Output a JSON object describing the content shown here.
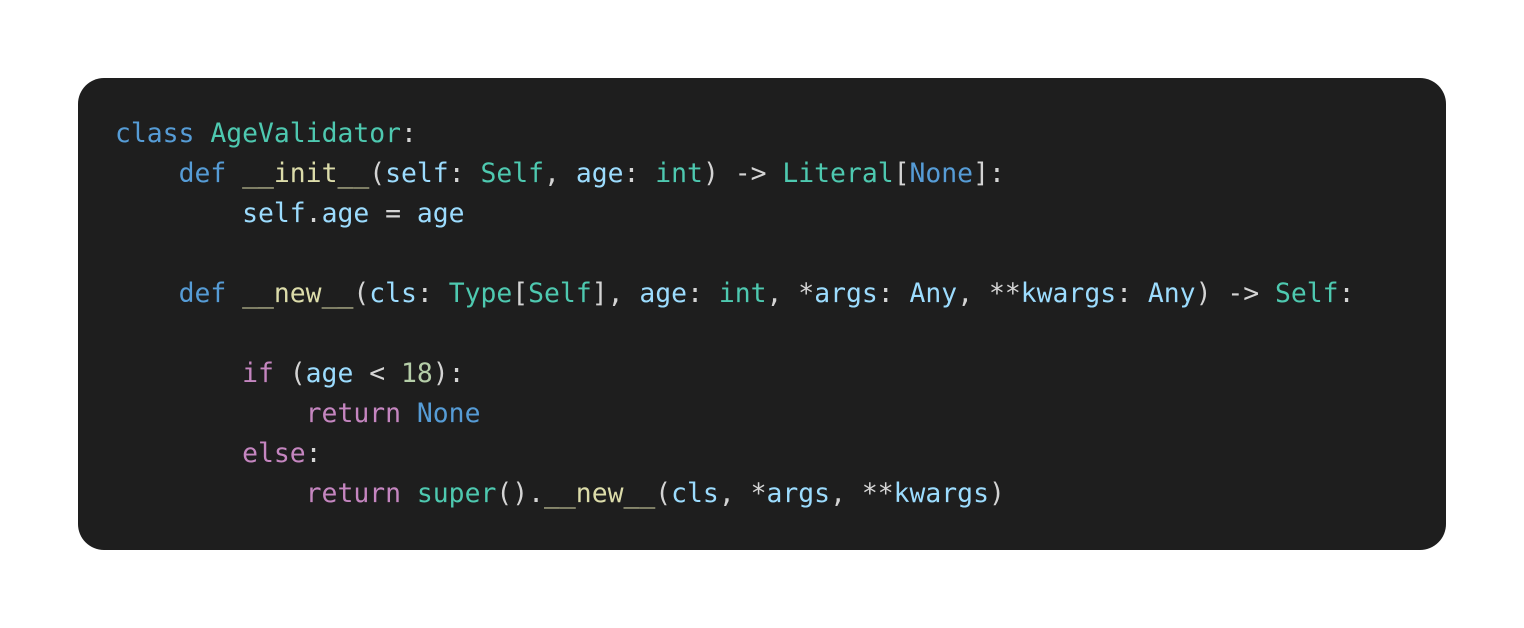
{
  "colors": {
    "background": "#ffffff",
    "card": "#1e1e1e",
    "keyword": "#569cd6",
    "control": "#c586c0",
    "class_type": "#4ec9b0",
    "function": "#dcdcaa",
    "variable": "#9cdcfe",
    "number": "#b5cea8",
    "punctuation": "#d4d4d4"
  },
  "code": {
    "language": "python",
    "lines": [
      [
        {
          "text": "class",
          "kind": "keyword"
        },
        {
          "text": " ",
          "kind": "punctuation"
        },
        {
          "text": "AgeValidator",
          "kind": "class_type"
        },
        {
          "text": ":",
          "kind": "punctuation"
        }
      ],
      [
        {
          "text": "    ",
          "kind": "punctuation"
        },
        {
          "text": "def",
          "kind": "keyword"
        },
        {
          "text": " ",
          "kind": "punctuation"
        },
        {
          "text": "__init__",
          "kind": "function"
        },
        {
          "text": "(",
          "kind": "punctuation"
        },
        {
          "text": "self",
          "kind": "variable"
        },
        {
          "text": ": ",
          "kind": "punctuation"
        },
        {
          "text": "Self",
          "kind": "class_type"
        },
        {
          "text": ", ",
          "kind": "punctuation"
        },
        {
          "text": "age",
          "kind": "variable"
        },
        {
          "text": ": ",
          "kind": "punctuation"
        },
        {
          "text": "int",
          "kind": "class_type"
        },
        {
          "text": ") -> ",
          "kind": "punctuation"
        },
        {
          "text": "Literal",
          "kind": "class_type"
        },
        {
          "text": "[",
          "kind": "punctuation"
        },
        {
          "text": "None",
          "kind": "keyword"
        },
        {
          "text": "]:",
          "kind": "punctuation"
        }
      ],
      [
        {
          "text": "        ",
          "kind": "punctuation"
        },
        {
          "text": "self",
          "kind": "variable"
        },
        {
          "text": ".",
          "kind": "punctuation"
        },
        {
          "text": "age",
          "kind": "variable"
        },
        {
          "text": " = ",
          "kind": "punctuation"
        },
        {
          "text": "age",
          "kind": "variable"
        }
      ],
      [],
      [
        {
          "text": "    ",
          "kind": "punctuation"
        },
        {
          "text": "def",
          "kind": "keyword"
        },
        {
          "text": " ",
          "kind": "punctuation"
        },
        {
          "text": "__new__",
          "kind": "function"
        },
        {
          "text": "(",
          "kind": "punctuation"
        },
        {
          "text": "cls",
          "kind": "variable"
        },
        {
          "text": ": ",
          "kind": "punctuation"
        },
        {
          "text": "Type",
          "kind": "class_type"
        },
        {
          "text": "[",
          "kind": "punctuation"
        },
        {
          "text": "Self",
          "kind": "class_type"
        },
        {
          "text": "], ",
          "kind": "punctuation"
        },
        {
          "text": "age",
          "kind": "variable"
        },
        {
          "text": ": ",
          "kind": "punctuation"
        },
        {
          "text": "int",
          "kind": "class_type"
        },
        {
          "text": ", *",
          "kind": "punctuation"
        },
        {
          "text": "args",
          "kind": "variable"
        },
        {
          "text": ": ",
          "kind": "punctuation"
        },
        {
          "text": "Any",
          "kind": "variable"
        },
        {
          "text": ", **",
          "kind": "punctuation"
        },
        {
          "text": "kwargs",
          "kind": "variable"
        },
        {
          "text": ": ",
          "kind": "punctuation"
        },
        {
          "text": "Any",
          "kind": "variable"
        },
        {
          "text": ") -> ",
          "kind": "punctuation"
        },
        {
          "text": "Self",
          "kind": "class_type"
        },
        {
          "text": ":",
          "kind": "punctuation"
        }
      ],
      [],
      [
        {
          "text": "        ",
          "kind": "punctuation"
        },
        {
          "text": "if",
          "kind": "control"
        },
        {
          "text": " (",
          "kind": "punctuation"
        },
        {
          "text": "age",
          "kind": "variable"
        },
        {
          "text": " < ",
          "kind": "punctuation"
        },
        {
          "text": "18",
          "kind": "number"
        },
        {
          "text": "):",
          "kind": "punctuation"
        }
      ],
      [
        {
          "text": "            ",
          "kind": "punctuation"
        },
        {
          "text": "return",
          "kind": "control"
        },
        {
          "text": " ",
          "kind": "punctuation"
        },
        {
          "text": "None",
          "kind": "keyword"
        }
      ],
      [
        {
          "text": "        ",
          "kind": "punctuation"
        },
        {
          "text": "else",
          "kind": "control"
        },
        {
          "text": ":",
          "kind": "punctuation"
        }
      ],
      [
        {
          "text": "            ",
          "kind": "punctuation"
        },
        {
          "text": "return",
          "kind": "control"
        },
        {
          "text": " ",
          "kind": "punctuation"
        },
        {
          "text": "super",
          "kind": "class_type"
        },
        {
          "text": "().",
          "kind": "punctuation"
        },
        {
          "text": "__new__",
          "kind": "function"
        },
        {
          "text": "(",
          "kind": "punctuation"
        },
        {
          "text": "cls",
          "kind": "variable"
        },
        {
          "text": ", *",
          "kind": "punctuation"
        },
        {
          "text": "args",
          "kind": "variable"
        },
        {
          "text": ", **",
          "kind": "punctuation"
        },
        {
          "text": "kwargs",
          "kind": "variable"
        },
        {
          "text": ")",
          "kind": "punctuation"
        }
      ]
    ]
  }
}
